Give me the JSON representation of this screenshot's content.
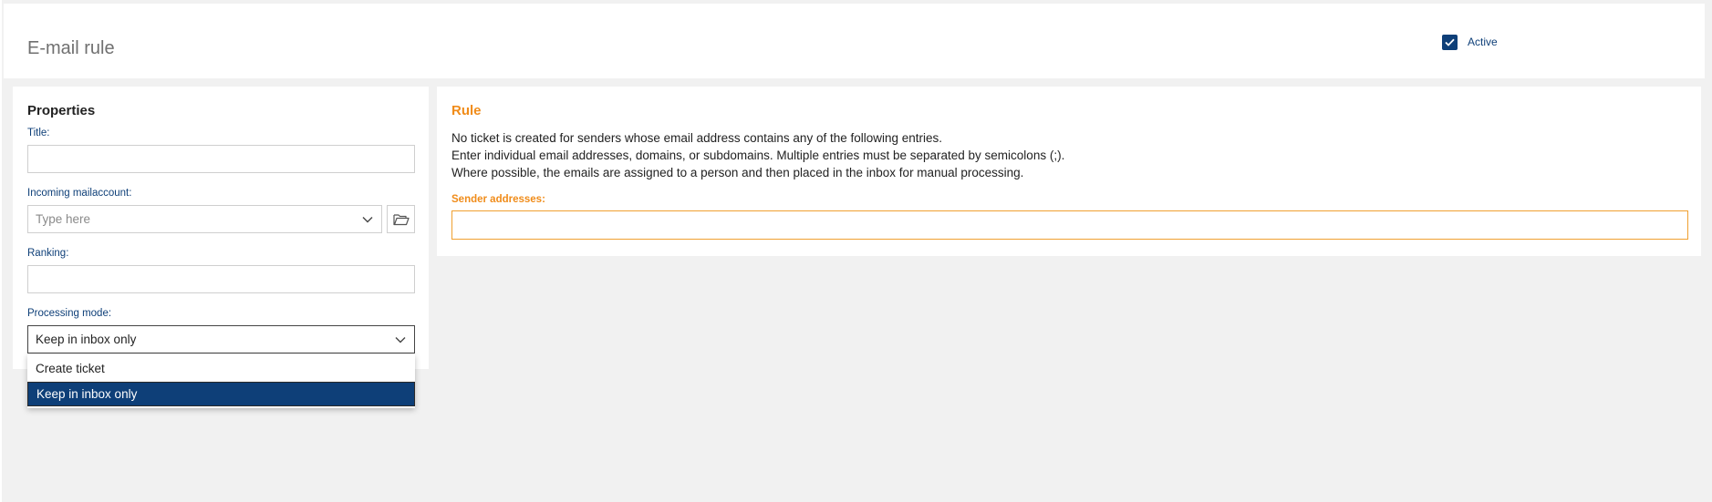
{
  "header": {
    "title": "E-mail rule",
    "active_label": "Active",
    "active_checked": true
  },
  "properties": {
    "title": "Properties",
    "title_label": "Title:",
    "title_value": "",
    "mailaccount_label": "Incoming mailaccount:",
    "mailaccount_placeholder": "Type here",
    "ranking_label": "Ranking:",
    "ranking_value": "",
    "processing_label": "Processing mode:",
    "processing_value": "Keep in inbox only",
    "processing_options": [
      "Create ticket",
      "Keep in inbox only"
    ]
  },
  "rule": {
    "title": "Rule",
    "lines": [
      "No ticket is created for senders whose email address contains any of the following entries.",
      "Enter individual email addresses, domains, or subdomains. Multiple entries must be separated by semicolons (;).",
      "Where possible, the emails are assigned to a person and then placed in the inbox for manual processing."
    ],
    "sender_label": "Sender addresses:",
    "sender_value": ""
  },
  "colors": {
    "primary": "#0e3f78",
    "accent": "#f0a030",
    "background": "#f1f1f1"
  },
  "icons": {
    "checkbox": "check-icon",
    "select": "chevron-down-icon",
    "browse": "folder-open-icon"
  }
}
